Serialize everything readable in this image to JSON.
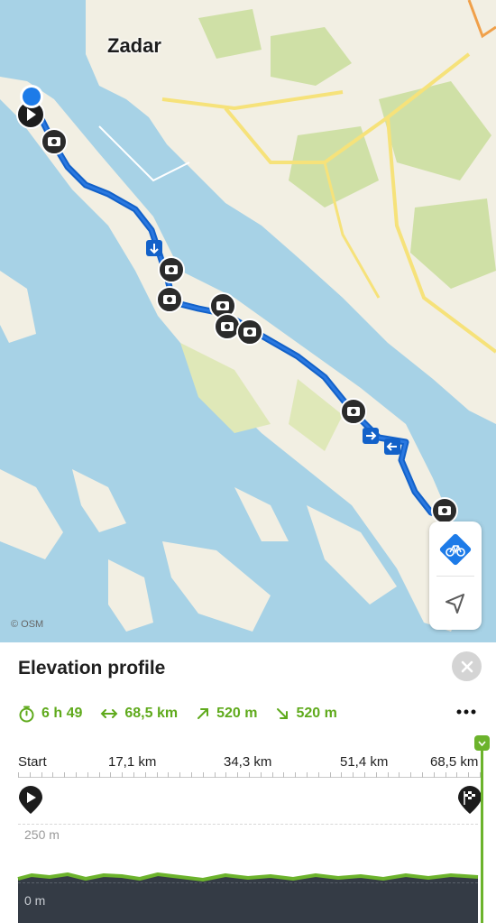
{
  "map": {
    "city": "Zadar",
    "attribution": "© OSM",
    "colors": {
      "water": "#a7d2e6",
      "land": "#f2efe3",
      "green": "#cfe0a6",
      "route": "#1261c9",
      "road": "#f6e27a"
    },
    "icons": [
      "location-dot-icon",
      "camera-icon",
      "direction-arrow-icon",
      "start-flag-icon"
    ]
  },
  "controls": {
    "activity_icon": "bike-route-icon",
    "locate_icon": "navigation-arrow-icon"
  },
  "panel": {
    "title": "Elevation profile",
    "stats": {
      "duration": "6 h 49",
      "distance": "68,5 km",
      "ascent": "520 m",
      "descent": "520 m"
    },
    "accent": "#5faa1c"
  },
  "profile": {
    "ticks": [
      "Start",
      "17,1 km",
      "34,3 km",
      "51,4 km",
      "68,5 km"
    ],
    "elevation_labels": {
      "high": "250 m",
      "low": "0 m"
    },
    "fill_color": "#343b45",
    "line_color": "#6cb32c"
  }
}
